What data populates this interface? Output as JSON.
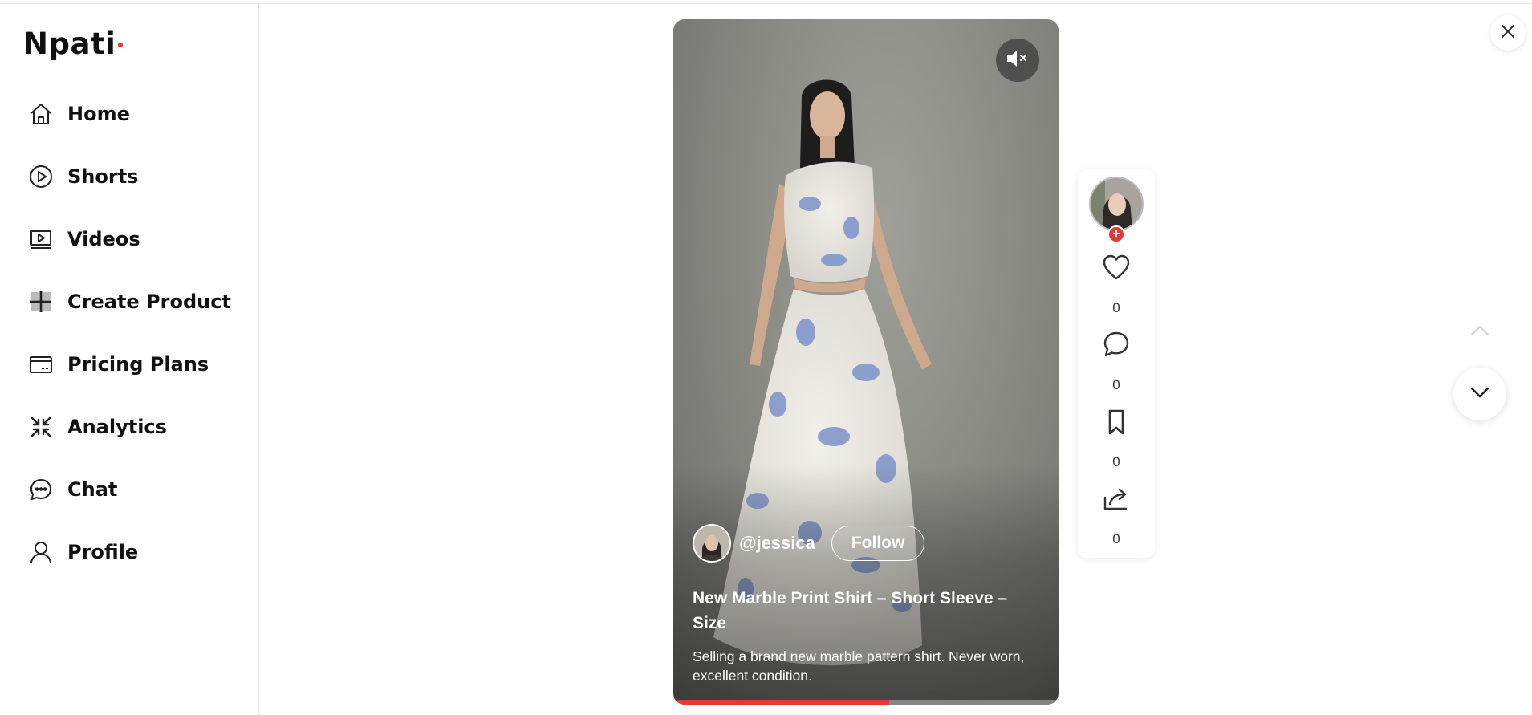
{
  "brand": {
    "name": "Npati",
    "accent": "#e53935"
  },
  "sidebar": {
    "items": [
      {
        "label": "Home",
        "icon": "home-icon"
      },
      {
        "label": "Shorts",
        "icon": "play-circle-icon"
      },
      {
        "label": "Videos",
        "icon": "video-icon"
      },
      {
        "label": "Create Product",
        "icon": "plus-icon"
      },
      {
        "label": "Pricing Plans",
        "icon": "card-icon"
      },
      {
        "label": "Analytics",
        "icon": "analytics-icon"
      },
      {
        "label": "Chat",
        "icon": "chat-icon"
      },
      {
        "label": "Profile",
        "icon": "user-icon"
      }
    ]
  },
  "video": {
    "author": "@jessica",
    "follow_label": "Follow",
    "title": "New Marble Print Shirt – Short Sleeve – Size",
    "description": "Selling a brand new marble pattern shirt. Never worn, excellent condition.",
    "progress": 0.56,
    "mute_icon": "volume-mute-icon"
  },
  "actions": {
    "likes": "0",
    "comments": "0",
    "saves": "0",
    "shares": "0"
  },
  "controls": {
    "close_icon": "close-icon",
    "up_icon": "chevron-up-icon",
    "down_icon": "chevron-down-icon"
  }
}
